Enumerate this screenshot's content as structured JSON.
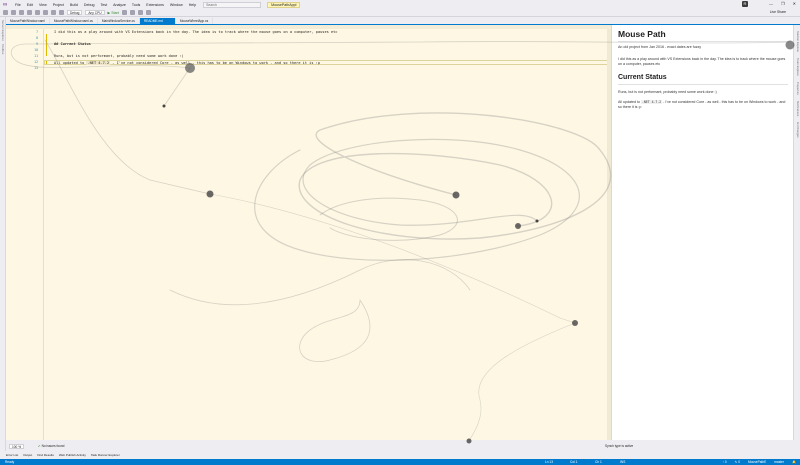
{
  "titlebar": {
    "menu": [
      "File",
      "Edit",
      "View",
      "Project",
      "Build",
      "Debug",
      "Test",
      "Analyze",
      "Tools",
      "Extensions",
      "Window",
      "Help"
    ],
    "search_placeholder": "Search",
    "window_title": "MousePathAppl",
    "user_initials": "R",
    "controls": [
      "—",
      "❐",
      "✕"
    ]
  },
  "toolbar": {
    "config": "Debug",
    "platform": "Any CPU",
    "start_label": "▶ Start",
    "live_share": "Live Share"
  },
  "left_strip": [
    "Server Explorer",
    "Toolbox"
  ],
  "tabs": [
    {
      "label": "MousePathWindow.xaml",
      "active": false
    },
    {
      "label": "MousePathWindow.xaml.cs",
      "active": false
    },
    {
      "label": "MainWindowService.cs",
      "active": false
    },
    {
      "label": "README.md",
      "active": true
    },
    {
      "label": "MouseWheelApp.cs",
      "active": false
    }
  ],
  "editor": {
    "line_numbers": [
      "7",
      "8",
      "9",
      "10",
      "11",
      "12",
      "13"
    ],
    "lines": [
      {
        "text": "I did this as a play around with VS Extensions back in the day. The idea is to track where the mouse goes on a computer, pauses etc",
        "heading": false
      },
      {
        "text": "",
        "heading": false
      },
      {
        "text": "## Current Status",
        "heading": true
      },
      {
        "text": "",
        "heading": false
      },
      {
        "text": "Runs, but is not performant, probably need some work done :)",
        "heading": false
      },
      {
        "text": "",
        "heading": false
      },
      {
        "pre": "All updated to ",
        "code": ".NET 4.7.2",
        "post": " - I've not considered Core - as well - this has to be on Windows to work - and so there it is :p",
        "heading": false
      }
    ],
    "zoom": "100 %",
    "issues": "No issues found"
  },
  "preview": {
    "title": "Mouse Path",
    "intro": "An old project from Jan 2016 - exact dates are fuzzy",
    "para1": "I did this as a play around with VS Extensions back in the day. The idea is to track where the mouse goes on a computer, pauses etc",
    "status_heading": "Current Status",
    "para2": "Runs, but is not performant, probably need some work done :)",
    "para3_pre": "All updated to ",
    "para3_code": ".NET 4.7.2",
    "para3_post": " - I've not considered Core - as well - this has to be on Windows to work - and so there it is :p",
    "footer": "Synch type is active"
  },
  "right_strip": [
    "Solution Explorer",
    "Team Explorer",
    "Properties",
    "Notifications",
    "Git Changes"
  ],
  "bottom_tabs": [
    "Error List",
    "Output",
    "Find Results",
    "Web Publish Activity",
    "Task Runner Explorer"
  ],
  "statusbar": {
    "left": "Ready",
    "ln": "Ln 13",
    "col": "Col 1",
    "ch": "Ch 1",
    "ins": "INS",
    "right": [
      "↑ 0",
      "✎ 0",
      "MousePathE",
      "master",
      "🔔"
    ]
  }
}
